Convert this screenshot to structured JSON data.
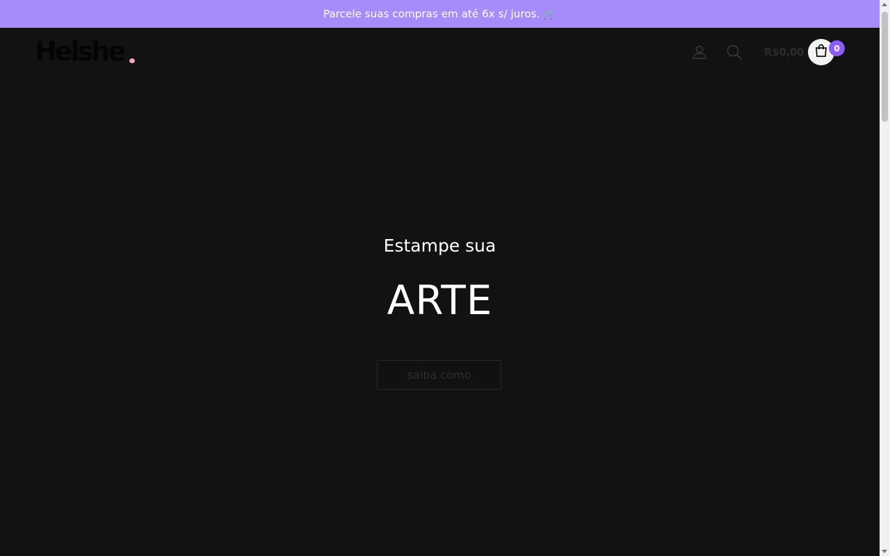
{
  "promo": {
    "text": "Parcele suas compras em até 6x s/ juros. 🛒"
  },
  "header": {
    "logo_text": "Helshe",
    "cart_total": "R$0,00",
    "cart_count": "0",
    "icons": {
      "account": "user-icon",
      "search": "search-icon",
      "cart": "shopping-bag-icon"
    }
  },
  "hero": {
    "subtitle": "Estampe sua",
    "title": "ARTE",
    "cta_label": "saiba como"
  },
  "colors": {
    "promo_bar": "#a78bfa",
    "background": "#121212",
    "badge": "#8b5cf6",
    "logo_dot": "#f5a3c7"
  }
}
